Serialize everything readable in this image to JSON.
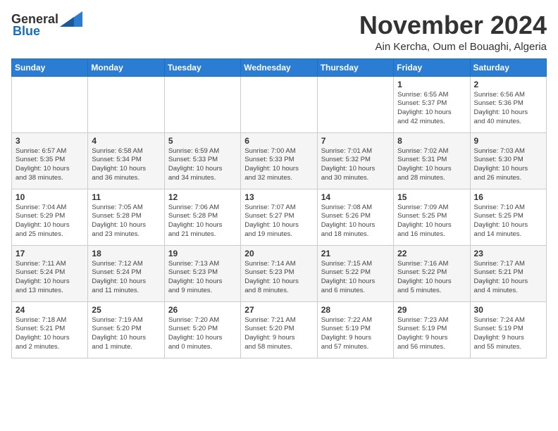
{
  "header": {
    "logo_general": "General",
    "logo_blue": "Blue",
    "month": "November 2024",
    "location": "Ain Kercha, Oum el Bouaghi, Algeria"
  },
  "weekdays": [
    "Sunday",
    "Monday",
    "Tuesday",
    "Wednesday",
    "Thursday",
    "Friday",
    "Saturday"
  ],
  "weeks": [
    [
      {
        "day": "",
        "info": ""
      },
      {
        "day": "",
        "info": ""
      },
      {
        "day": "",
        "info": ""
      },
      {
        "day": "",
        "info": ""
      },
      {
        "day": "",
        "info": ""
      },
      {
        "day": "1",
        "info": "Sunrise: 6:55 AM\nSunset: 5:37 PM\nDaylight: 10 hours\nand 42 minutes."
      },
      {
        "day": "2",
        "info": "Sunrise: 6:56 AM\nSunset: 5:36 PM\nDaylight: 10 hours\nand 40 minutes."
      }
    ],
    [
      {
        "day": "3",
        "info": "Sunrise: 6:57 AM\nSunset: 5:35 PM\nDaylight: 10 hours\nand 38 minutes."
      },
      {
        "day": "4",
        "info": "Sunrise: 6:58 AM\nSunset: 5:34 PM\nDaylight: 10 hours\nand 36 minutes."
      },
      {
        "day": "5",
        "info": "Sunrise: 6:59 AM\nSunset: 5:33 PM\nDaylight: 10 hours\nand 34 minutes."
      },
      {
        "day": "6",
        "info": "Sunrise: 7:00 AM\nSunset: 5:33 PM\nDaylight: 10 hours\nand 32 minutes."
      },
      {
        "day": "7",
        "info": "Sunrise: 7:01 AM\nSunset: 5:32 PM\nDaylight: 10 hours\nand 30 minutes."
      },
      {
        "day": "8",
        "info": "Sunrise: 7:02 AM\nSunset: 5:31 PM\nDaylight: 10 hours\nand 28 minutes."
      },
      {
        "day": "9",
        "info": "Sunrise: 7:03 AM\nSunset: 5:30 PM\nDaylight: 10 hours\nand 26 minutes."
      }
    ],
    [
      {
        "day": "10",
        "info": "Sunrise: 7:04 AM\nSunset: 5:29 PM\nDaylight: 10 hours\nand 25 minutes."
      },
      {
        "day": "11",
        "info": "Sunrise: 7:05 AM\nSunset: 5:28 PM\nDaylight: 10 hours\nand 23 minutes."
      },
      {
        "day": "12",
        "info": "Sunrise: 7:06 AM\nSunset: 5:28 PM\nDaylight: 10 hours\nand 21 minutes."
      },
      {
        "day": "13",
        "info": "Sunrise: 7:07 AM\nSunset: 5:27 PM\nDaylight: 10 hours\nand 19 minutes."
      },
      {
        "day": "14",
        "info": "Sunrise: 7:08 AM\nSunset: 5:26 PM\nDaylight: 10 hours\nand 18 minutes."
      },
      {
        "day": "15",
        "info": "Sunrise: 7:09 AM\nSunset: 5:25 PM\nDaylight: 10 hours\nand 16 minutes."
      },
      {
        "day": "16",
        "info": "Sunrise: 7:10 AM\nSunset: 5:25 PM\nDaylight: 10 hours\nand 14 minutes."
      }
    ],
    [
      {
        "day": "17",
        "info": "Sunrise: 7:11 AM\nSunset: 5:24 PM\nDaylight: 10 hours\nand 13 minutes."
      },
      {
        "day": "18",
        "info": "Sunrise: 7:12 AM\nSunset: 5:24 PM\nDaylight: 10 hours\nand 11 minutes."
      },
      {
        "day": "19",
        "info": "Sunrise: 7:13 AM\nSunset: 5:23 PM\nDaylight: 10 hours\nand 9 minutes."
      },
      {
        "day": "20",
        "info": "Sunrise: 7:14 AM\nSunset: 5:23 PM\nDaylight: 10 hours\nand 8 minutes."
      },
      {
        "day": "21",
        "info": "Sunrise: 7:15 AM\nSunset: 5:22 PM\nDaylight: 10 hours\nand 6 minutes."
      },
      {
        "day": "22",
        "info": "Sunrise: 7:16 AM\nSunset: 5:22 PM\nDaylight: 10 hours\nand 5 minutes."
      },
      {
        "day": "23",
        "info": "Sunrise: 7:17 AM\nSunset: 5:21 PM\nDaylight: 10 hours\nand 4 minutes."
      }
    ],
    [
      {
        "day": "24",
        "info": "Sunrise: 7:18 AM\nSunset: 5:21 PM\nDaylight: 10 hours\nand 2 minutes."
      },
      {
        "day": "25",
        "info": "Sunrise: 7:19 AM\nSunset: 5:20 PM\nDaylight: 10 hours\nand 1 minute."
      },
      {
        "day": "26",
        "info": "Sunrise: 7:20 AM\nSunset: 5:20 PM\nDaylight: 10 hours\nand 0 minutes."
      },
      {
        "day": "27",
        "info": "Sunrise: 7:21 AM\nSunset: 5:20 PM\nDaylight: 9 hours\nand 58 minutes."
      },
      {
        "day": "28",
        "info": "Sunrise: 7:22 AM\nSunset: 5:19 PM\nDaylight: 9 hours\nand 57 minutes."
      },
      {
        "day": "29",
        "info": "Sunrise: 7:23 AM\nSunset: 5:19 PM\nDaylight: 9 hours\nand 56 minutes."
      },
      {
        "day": "30",
        "info": "Sunrise: 7:24 AM\nSunset: 5:19 PM\nDaylight: 9 hours\nand 55 minutes."
      }
    ]
  ]
}
